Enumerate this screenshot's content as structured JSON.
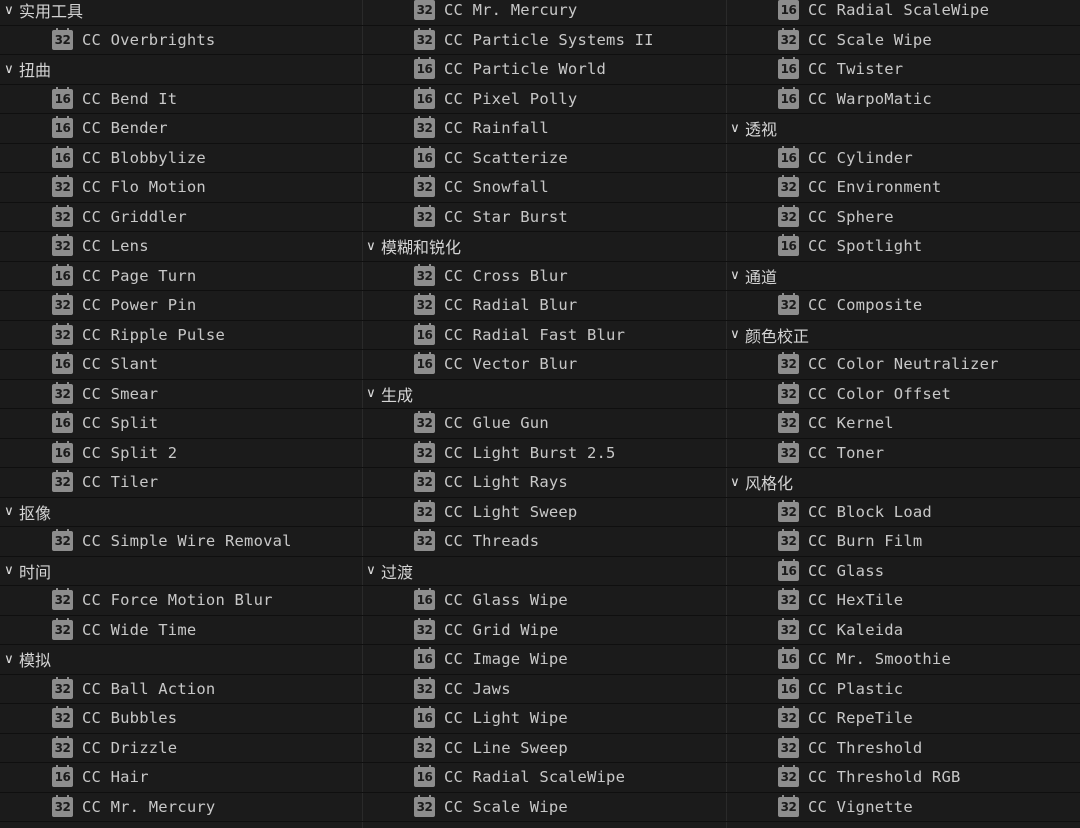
{
  "columns": [
    [
      {
        "type": "category",
        "label": "实用工具"
      },
      {
        "type": "effect",
        "bits": "32",
        "label": "CC Overbrights"
      },
      {
        "type": "category",
        "label": "扭曲"
      },
      {
        "type": "effect",
        "bits": "16",
        "label": "CC Bend It"
      },
      {
        "type": "effect",
        "bits": "16",
        "label": "CC Bender"
      },
      {
        "type": "effect",
        "bits": "16",
        "label": "CC Blobbylize"
      },
      {
        "type": "effect",
        "bits": "32",
        "label": "CC Flo Motion"
      },
      {
        "type": "effect",
        "bits": "32",
        "label": "CC Griddler"
      },
      {
        "type": "effect",
        "bits": "32",
        "label": "CC Lens"
      },
      {
        "type": "effect",
        "bits": "16",
        "label": "CC Page Turn"
      },
      {
        "type": "effect",
        "bits": "32",
        "label": "CC Power Pin"
      },
      {
        "type": "effect",
        "bits": "32",
        "label": "CC Ripple Pulse"
      },
      {
        "type": "effect",
        "bits": "16",
        "label": "CC Slant"
      },
      {
        "type": "effect",
        "bits": "32",
        "label": "CC Smear"
      },
      {
        "type": "effect",
        "bits": "16",
        "label": "CC Split"
      },
      {
        "type": "effect",
        "bits": "16",
        "label": "CC Split 2"
      },
      {
        "type": "effect",
        "bits": "32",
        "label": "CC Tiler"
      },
      {
        "type": "category",
        "label": "抠像"
      },
      {
        "type": "effect",
        "bits": "32",
        "label": "CC Simple Wire Removal"
      },
      {
        "type": "category",
        "label": "时间"
      },
      {
        "type": "effect",
        "bits": "32",
        "label": "CC Force Motion Blur"
      },
      {
        "type": "effect",
        "bits": "32",
        "label": "CC Wide Time"
      },
      {
        "type": "category",
        "label": "模拟"
      },
      {
        "type": "effect",
        "bits": "32",
        "label": "CC Ball Action"
      },
      {
        "type": "effect",
        "bits": "32",
        "label": "CC Bubbles"
      },
      {
        "type": "effect",
        "bits": "32",
        "label": "CC Drizzle"
      },
      {
        "type": "effect",
        "bits": "16",
        "label": "CC Hair"
      },
      {
        "type": "effect",
        "bits": "32",
        "label": "CC Mr. Mercury"
      }
    ],
    [
      {
        "type": "effect",
        "bits": "32",
        "label": "CC Mr. Mercury"
      },
      {
        "type": "effect",
        "bits": "32",
        "label": "CC Particle Systems II"
      },
      {
        "type": "effect",
        "bits": "16",
        "label": "CC Particle World"
      },
      {
        "type": "effect",
        "bits": "16",
        "label": "CC Pixel Polly"
      },
      {
        "type": "effect",
        "bits": "32",
        "label": "CC Rainfall"
      },
      {
        "type": "effect",
        "bits": "16",
        "label": "CC Scatterize"
      },
      {
        "type": "effect",
        "bits": "32",
        "label": "CC Snowfall"
      },
      {
        "type": "effect",
        "bits": "32",
        "label": "CC Star Burst"
      },
      {
        "type": "category",
        "label": "模糊和锐化"
      },
      {
        "type": "effect",
        "bits": "32",
        "label": "CC Cross Blur"
      },
      {
        "type": "effect",
        "bits": "32",
        "label": "CC Radial Blur"
      },
      {
        "type": "effect",
        "bits": "16",
        "label": "CC Radial Fast Blur"
      },
      {
        "type": "effect",
        "bits": "16",
        "label": "CC Vector Blur"
      },
      {
        "type": "category",
        "label": "生成"
      },
      {
        "type": "effect",
        "bits": "32",
        "label": "CC Glue Gun"
      },
      {
        "type": "effect",
        "bits": "32",
        "label": "CC Light Burst 2.5"
      },
      {
        "type": "effect",
        "bits": "32",
        "label": "CC Light Rays"
      },
      {
        "type": "effect",
        "bits": "32",
        "label": "CC Light Sweep"
      },
      {
        "type": "effect",
        "bits": "32",
        "label": "CC Threads"
      },
      {
        "type": "category",
        "label": "过渡"
      },
      {
        "type": "effect",
        "bits": "16",
        "label": "CC Glass Wipe"
      },
      {
        "type": "effect",
        "bits": "32",
        "label": "CC Grid Wipe"
      },
      {
        "type": "effect",
        "bits": "16",
        "label": "CC Image Wipe"
      },
      {
        "type": "effect",
        "bits": "32",
        "label": "CC Jaws"
      },
      {
        "type": "effect",
        "bits": "16",
        "label": "CC Light Wipe"
      },
      {
        "type": "effect",
        "bits": "32",
        "label": "CC Line Sweep"
      },
      {
        "type": "effect",
        "bits": "16",
        "label": "CC Radial ScaleWipe"
      },
      {
        "type": "effect",
        "bits": "32",
        "label": "CC Scale Wipe"
      }
    ],
    [
      {
        "type": "effect",
        "bits": "16",
        "label": "CC Radial ScaleWipe"
      },
      {
        "type": "effect",
        "bits": "32",
        "label": "CC Scale Wipe"
      },
      {
        "type": "effect",
        "bits": "16",
        "label": "CC Twister"
      },
      {
        "type": "effect",
        "bits": "16",
        "label": "CC WarpoMatic"
      },
      {
        "type": "category",
        "label": "透视"
      },
      {
        "type": "effect",
        "bits": "16",
        "label": "CC Cylinder"
      },
      {
        "type": "effect",
        "bits": "32",
        "label": "CC Environment"
      },
      {
        "type": "effect",
        "bits": "32",
        "label": "CC Sphere"
      },
      {
        "type": "effect",
        "bits": "16",
        "label": "CC Spotlight"
      },
      {
        "type": "category",
        "label": "通道"
      },
      {
        "type": "effect",
        "bits": "32",
        "label": "CC Composite"
      },
      {
        "type": "category",
        "label": "颜色校正"
      },
      {
        "type": "effect",
        "bits": "32",
        "label": "CC Color Neutralizer"
      },
      {
        "type": "effect",
        "bits": "32",
        "label": "CC Color Offset"
      },
      {
        "type": "effect",
        "bits": "32",
        "label": "CC Kernel"
      },
      {
        "type": "effect",
        "bits": "32",
        "label": "CC Toner"
      },
      {
        "type": "category",
        "label": "风格化"
      },
      {
        "type": "effect",
        "bits": "32",
        "label": "CC Block Load"
      },
      {
        "type": "effect",
        "bits": "32",
        "label": "CC Burn Film"
      },
      {
        "type": "effect",
        "bits": "16",
        "label": "CC Glass"
      },
      {
        "type": "effect",
        "bits": "32",
        "label": "CC HexTile"
      },
      {
        "type": "effect",
        "bits": "32",
        "label": "CC Kaleida"
      },
      {
        "type": "effect",
        "bits": "16",
        "label": "CC Mr. Smoothie"
      },
      {
        "type": "effect",
        "bits": "16",
        "label": "CC Plastic"
      },
      {
        "type": "effect",
        "bits": "32",
        "label": "CC RepeTile"
      },
      {
        "type": "effect",
        "bits": "32",
        "label": "CC Threshold"
      },
      {
        "type": "effect",
        "bits": "32",
        "label": "CC Threshold RGB"
      },
      {
        "type": "effect",
        "bits": "32",
        "label": "CC Vignette"
      }
    ]
  ]
}
